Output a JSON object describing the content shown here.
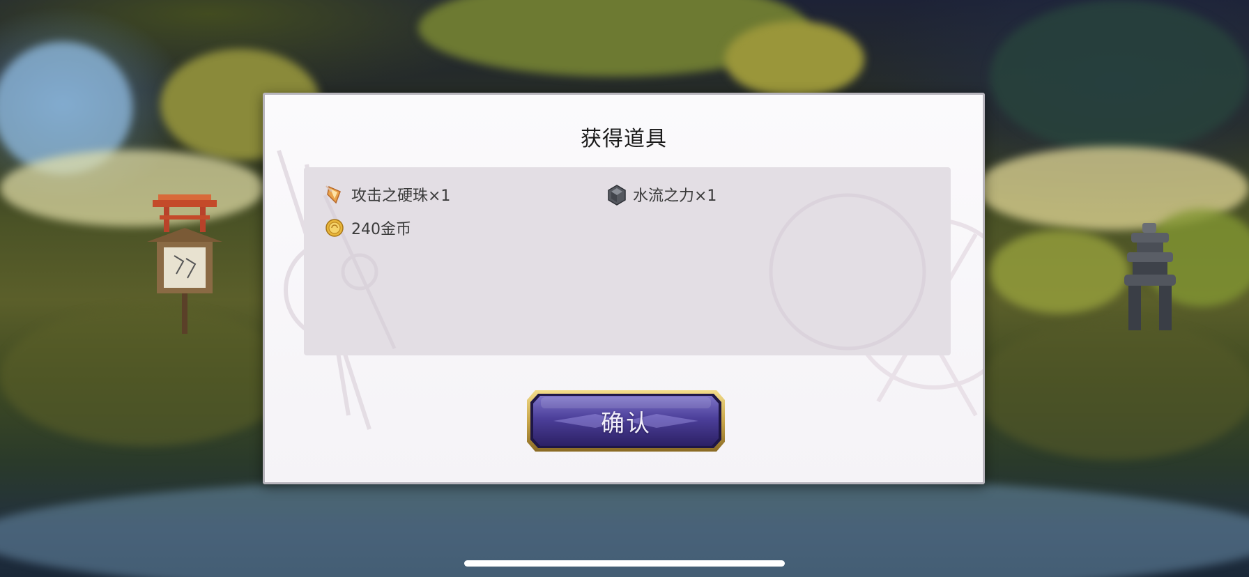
{
  "dialog": {
    "title": "获得道具",
    "items": [
      {
        "icon": "attack-orb-icon",
        "label": "攻击之硬珠×1"
      },
      {
        "icon": "water-stone-icon",
        "label": "水流之力×1"
      },
      {
        "icon": "gold-coin-icon",
        "label": "240金币"
      }
    ],
    "confirm_label": "确认"
  },
  "colors": {
    "dialog_bg": "#f7f5f9",
    "panel_bg": "#e3dee4",
    "button_purple": "#4b3f94",
    "button_gold": "#c9a64a",
    "home_indicator": "#ffffff"
  }
}
